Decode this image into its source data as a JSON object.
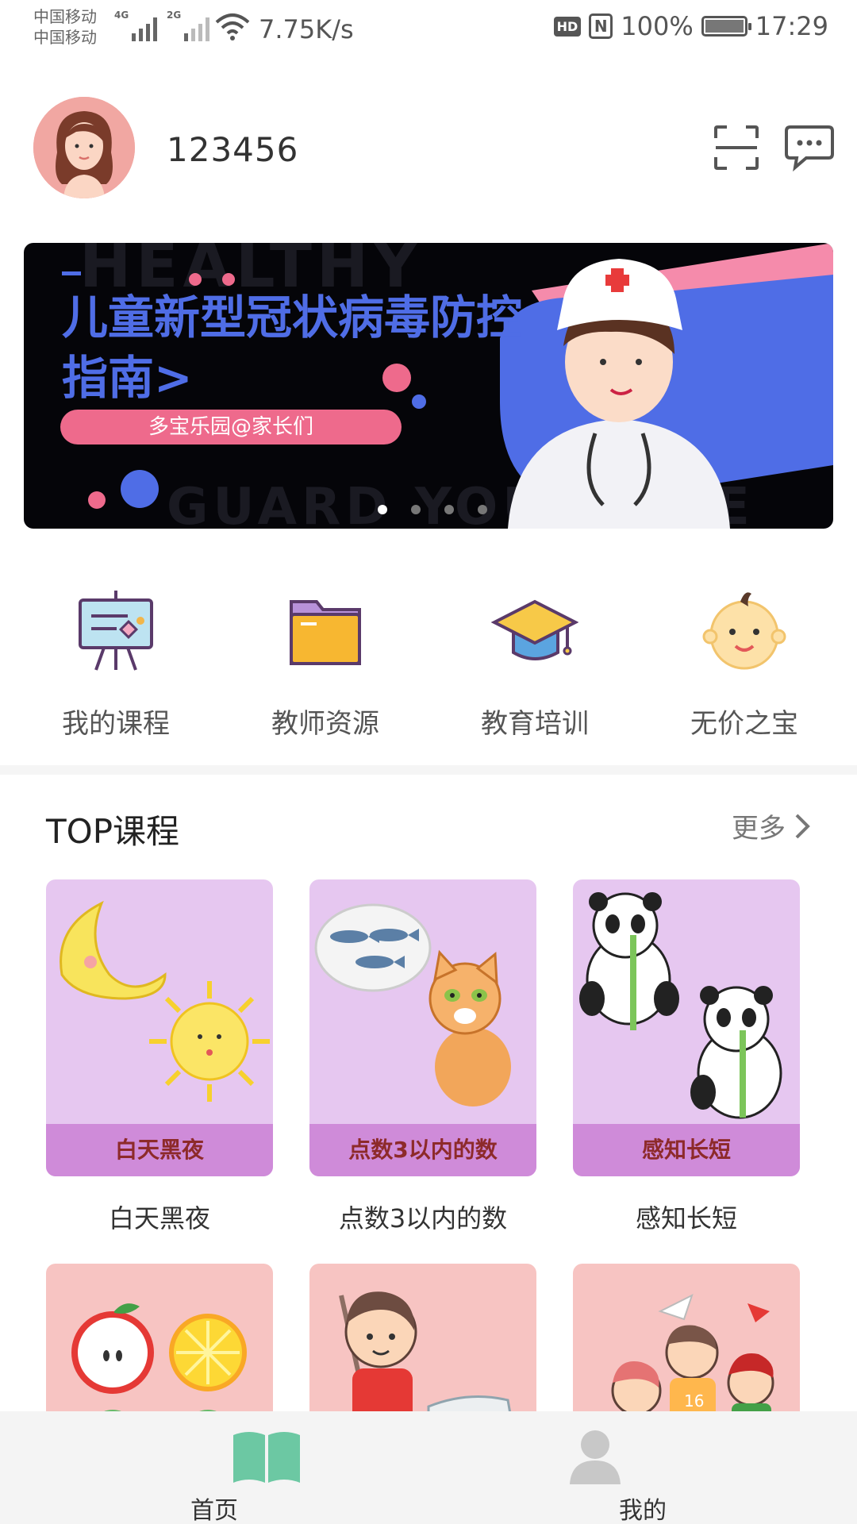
{
  "status_bar": {
    "carrier_1": "中国移动",
    "carrier_2": "中国移动",
    "net_1": "4G",
    "net_2": "2G",
    "speed": "7.75K/s",
    "hd": "HD",
    "battery": "100%",
    "time": "17:29"
  },
  "header": {
    "username": "123456"
  },
  "banner": {
    "title": "儿童新型冠状病毒防控指南>",
    "tag": "多宝乐园@家长们",
    "bg_word_1": "HEALTHY",
    "bg_word_2": "GUARD YOUR LIFE",
    "slide_count": 4,
    "active_slide": 1
  },
  "menu": [
    {
      "label": "我的课程",
      "icon": "presentation-board-icon"
    },
    {
      "label": "教师资源",
      "icon": "folder-icon"
    },
    {
      "label": "教育培训",
      "icon": "graduation-cap-icon"
    },
    {
      "label": "无价之宝",
      "icon": "baby-face-icon"
    }
  ],
  "top_courses": {
    "title": "TOP课程",
    "more": "更多",
    "courses": [
      {
        "strip": "白天黑夜",
        "name": "白天黑夜"
      },
      {
        "strip": "点数3以内的数",
        "name": "点数3以内的数"
      },
      {
        "strip": "感知长短",
        "name": "感知长短"
      }
    ]
  },
  "bottom_nav": {
    "home": "首页",
    "mine": "我的"
  },
  "colors": {
    "accent_green": "#6cc8a3",
    "banner_blue": "#4f6de6",
    "banner_pink": "#ee6a8c",
    "card_purple": "#e6c7f0",
    "card_pink": "#f7c4c2"
  }
}
